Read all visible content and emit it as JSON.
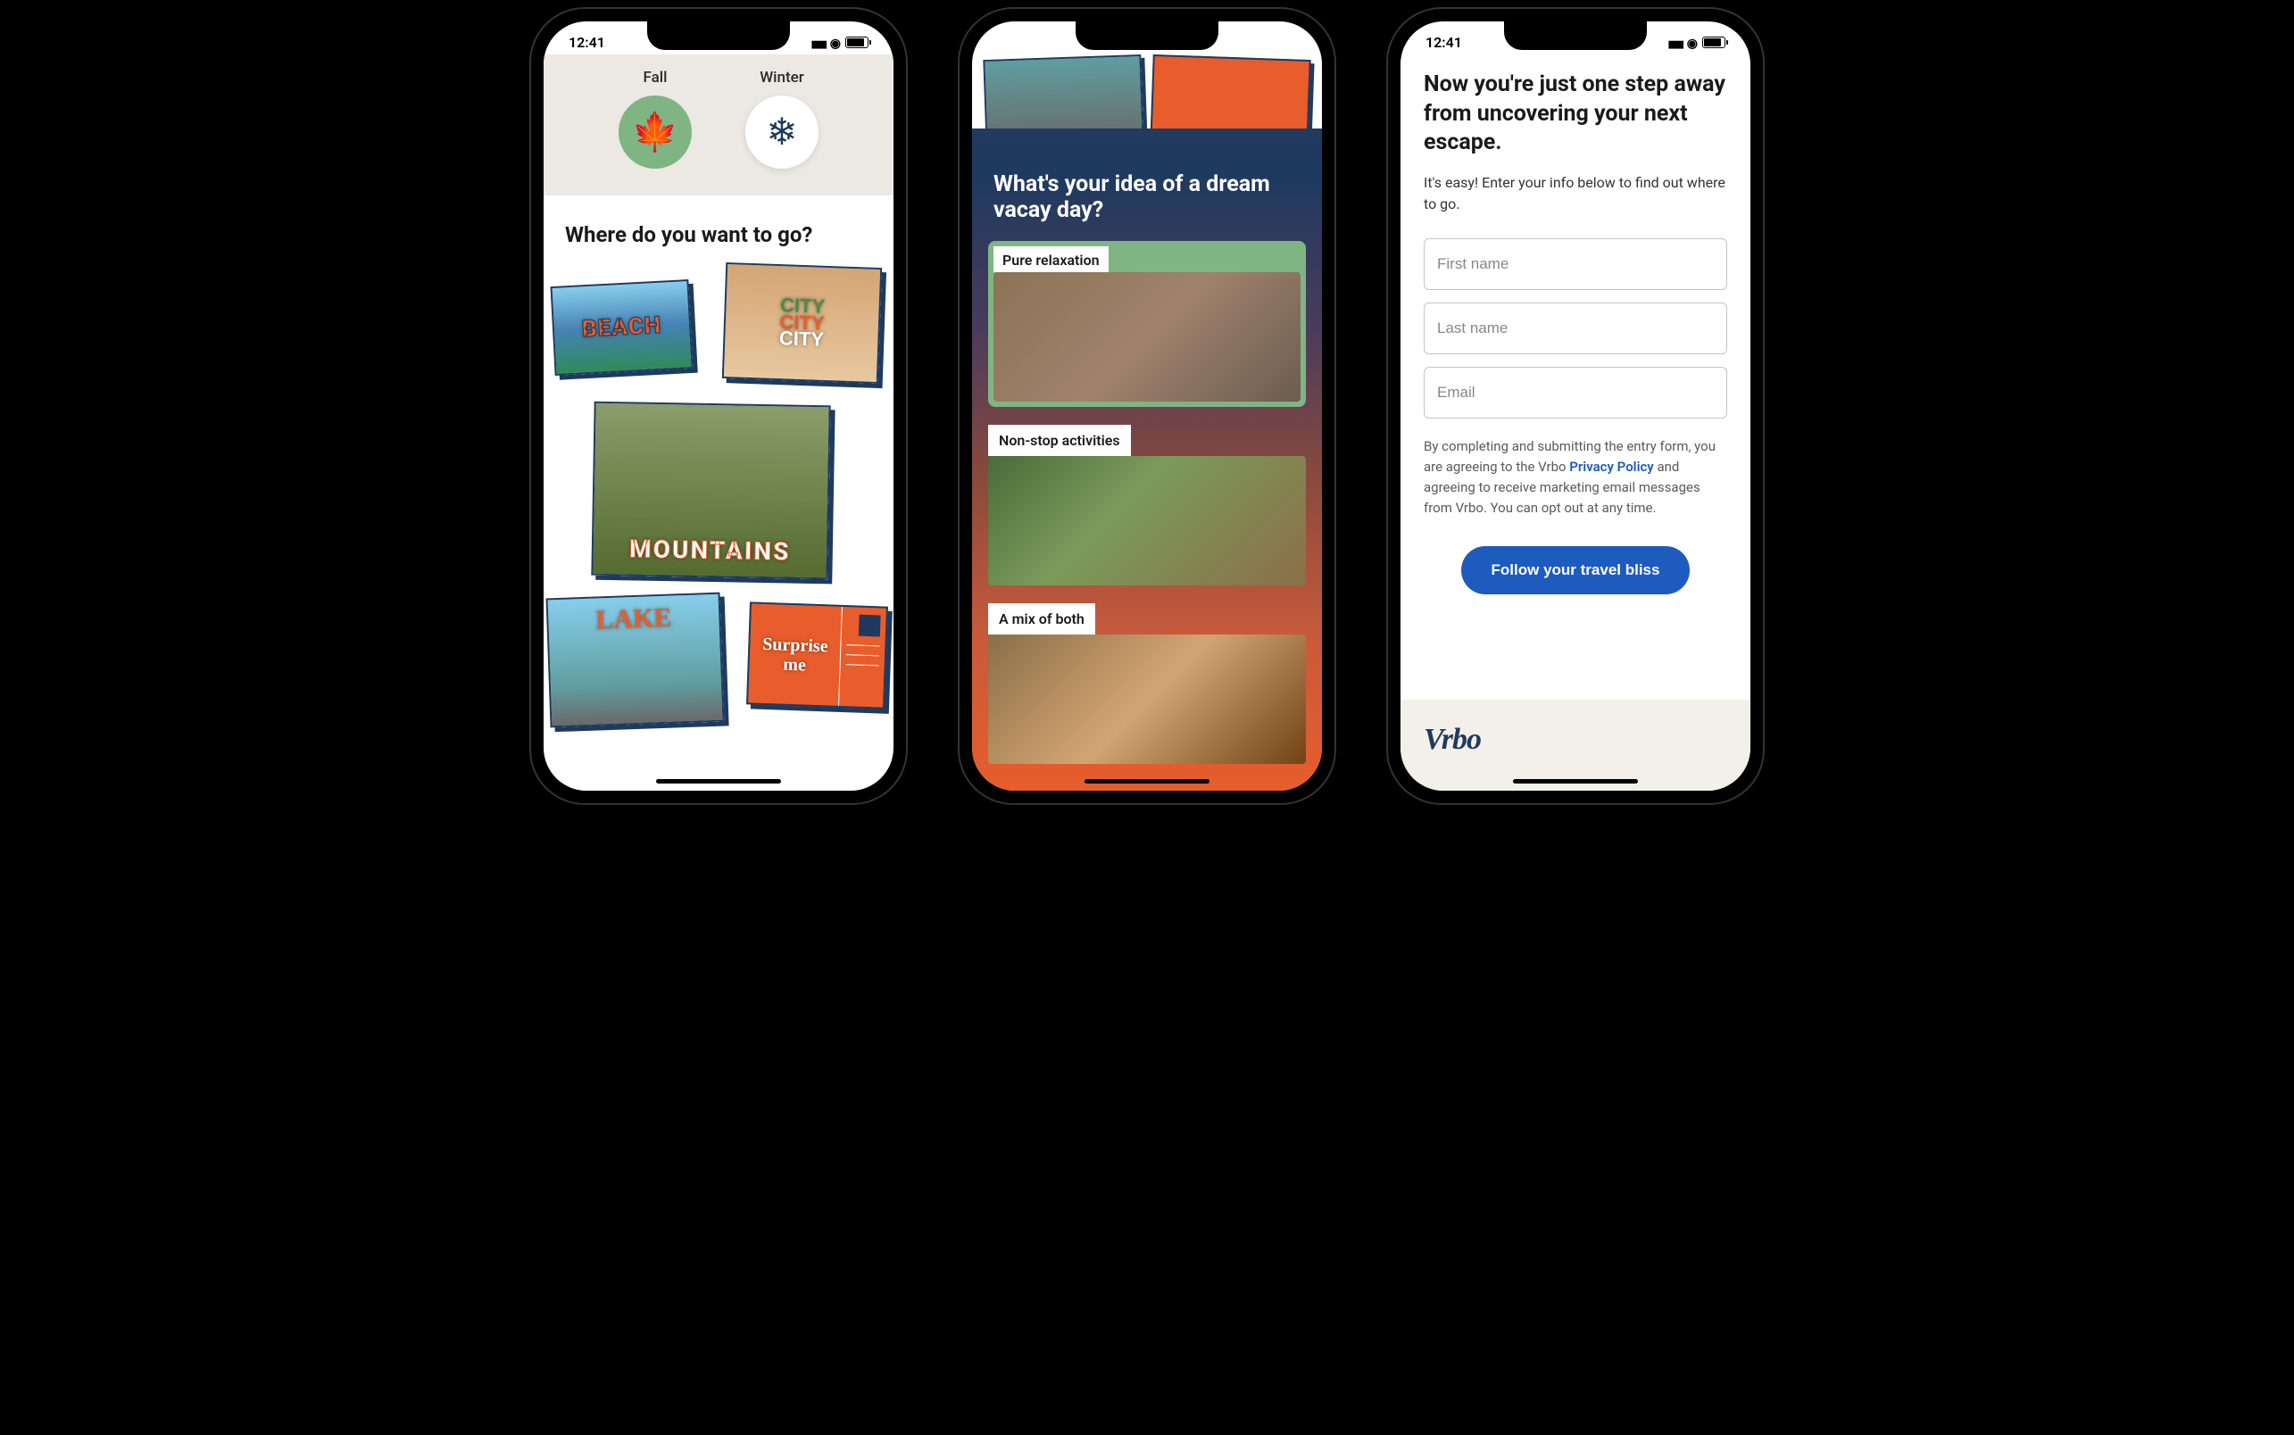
{
  "status": {
    "time": "12:41"
  },
  "screen1": {
    "seasons": [
      {
        "label": "Fall",
        "icon": "🍁",
        "class": "fall"
      },
      {
        "label": "Winter",
        "icon": "❄",
        "class": "winter"
      }
    ],
    "heading": "Where do you want to go?",
    "cards": {
      "beach": "BEACH",
      "city_l1": "CITY",
      "city_l2": "CITY",
      "city_l3": "CITY",
      "mountains": "MOUNTAINS",
      "lake": "LAKE",
      "surprise": "Surprise me"
    }
  },
  "screen2": {
    "heading": "What's your idea of a dream vacay day?",
    "options": [
      {
        "label": "Pure relaxation",
        "selected": true,
        "img": "img-relax"
      },
      {
        "label": "Non-stop activities",
        "selected": false,
        "img": "img-activity"
      },
      {
        "label": "A mix of both",
        "selected": false,
        "img": "img-mix"
      }
    ]
  },
  "screen3": {
    "heading": "Now you're just one step away from uncovering your next escape.",
    "subtext": "It's easy! Enter your info below to find out where to go.",
    "fields": {
      "first_name": "First name",
      "last_name": "Last name",
      "email": "Email"
    },
    "consent_pre": "By completing and submitting the entry form, you are agreeing to the Vrbo ",
    "consent_link": "Privacy Policy",
    "consent_post": " and agreeing to receive marketing email messages from Vrbo. You can opt out at any time.",
    "cta": "Follow your travel bliss",
    "logo": "Vrbo"
  }
}
